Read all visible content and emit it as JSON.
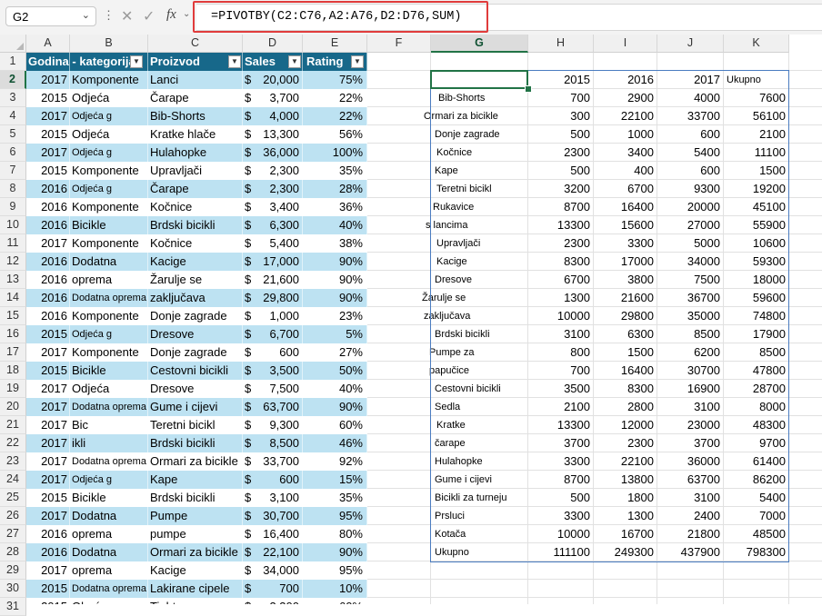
{
  "formula_bar": {
    "name_box": "G2",
    "formula": "=PIVOTBY(C2:C76,A2:A76,D2:D76,SUM)"
  },
  "icons": {
    "cancel": "x-icon",
    "enter": "checkmark-icon",
    "function": "fx-icon"
  },
  "columns": [
    "A",
    "B",
    "C",
    "D",
    "E",
    "F",
    "G",
    "H",
    "I",
    "J",
    "K"
  ],
  "selected_column": "G",
  "selected_row": "2",
  "rows": [
    "1",
    "2",
    "3",
    "4",
    "5",
    "6",
    "7",
    "8",
    "9",
    "10",
    "11",
    "12",
    "13",
    "14",
    "15",
    "16",
    "17",
    "18",
    "19",
    "20",
    "21",
    "22",
    "23",
    "24",
    "25",
    "26",
    "27",
    "28",
    "29",
    "30",
    "31"
  ],
  "table": {
    "headers": [
      "Godina - kategorija",
      "Proizvod",
      "Sales",
      "Rating"
    ],
    "rows": [
      {
        "year": "2017",
        "cat": "Komponente",
        "prod": "Lanci",
        "cur": "$",
        "sales": "20,000",
        "rating": "75%"
      },
      {
        "year": "2015",
        "cat": "Odjeća",
        "prod": "Čarape",
        "cur": "$",
        "sales": "3,700",
        "rating": "22%"
      },
      {
        "year": "2017",
        "cat": "Odjeća g",
        "prod": "Bib-Shorts",
        "cur": "$",
        "sales": "4,000",
        "rating": "22%"
      },
      {
        "year": "2015",
        "cat": "Odjeća",
        "prod": "Kratke hlače",
        "cur": "$",
        "sales": "13,300",
        "rating": "56%"
      },
      {
        "year": "2017",
        "cat": "Odjeća g",
        "prod": "Hulahopke",
        "cur": "$",
        "sales": "36,000",
        "rating": "100%"
      },
      {
        "year": "2015",
        "cat": "Komponente",
        "prod": "Upravljači",
        "cur": "$",
        "sales": "2,300",
        "rating": "35%"
      },
      {
        "year": "2016",
        "cat": "Odjeća g",
        "prod": "Čarape",
        "cur": "$",
        "sales": "2,300",
        "rating": "28%"
      },
      {
        "year": "2016",
        "cat": "Komponente",
        "prod": "Kočnice",
        "cur": "$",
        "sales": "3,400",
        "rating": "36%"
      },
      {
        "year": "2016",
        "cat": "Bicikle",
        "prod": "Brdski bicikli",
        "cur": "$",
        "sales": "6,300",
        "rating": "40%"
      },
      {
        "year": "2017",
        "cat": "Komponente",
        "prod": "Kočnice",
        "cur": "$",
        "sales": "5,400",
        "rating": "38%"
      },
      {
        "year": "2016",
        "cat": "Dodatna",
        "prod": "Kacige",
        "cur": "$",
        "sales": "17,000",
        "rating": "90%"
      },
      {
        "year": "2016",
        "cat": "oprema",
        "prod": "Žarulje se",
        "cur": "$",
        "sales": "21,600",
        "rating": "90%"
      },
      {
        "year": "2016",
        "cat": "Dodatna oprema",
        "prod": "zaključava",
        "cur": "$",
        "sales": "29,800",
        "rating": "90%"
      },
      {
        "year": "2016",
        "cat": "Komponente",
        "prod": "Donje zagrade",
        "cur": "$",
        "sales": "1,000",
        "rating": "23%"
      },
      {
        "year": "2015",
        "cat": "Odjeća g",
        "prod": "Dresove",
        "cur": "$",
        "sales": "6,700",
        "rating": "5%"
      },
      {
        "year": "2017",
        "cat": "Komponente",
        "prod": "Donje zagrade",
        "cur": "$",
        "sales": "600",
        "rating": "27%"
      },
      {
        "year": "2015",
        "cat": "Bicikle",
        "prod": "Cestovni bicikli",
        "cur": "$",
        "sales": "3,500",
        "rating": "50%"
      },
      {
        "year": "2017",
        "cat": "Odjeća",
        "prod": "Dresove",
        "cur": "$",
        "sales": "7,500",
        "rating": "40%"
      },
      {
        "year": "2017",
        "cat": "Dodatna oprema",
        "prod": "Gume i cijevi",
        "cur": "$",
        "sales": "63,700",
        "rating": "90%"
      },
      {
        "year": "2017",
        "cat": "Bic",
        "prod": "Teretni bicikl",
        "cur": "$",
        "sales": "9,300",
        "rating": "60%"
      },
      {
        "year": "2017",
        "cat": "ikli",
        "prod": "Brdski bicikli",
        "cur": "$",
        "sales": "8,500",
        "rating": "46%"
      },
      {
        "year": "2017",
        "cat": "Dodatna oprema",
        "prod": "Ormari za bicikle",
        "cur": "$",
        "sales": "33,700",
        "rating": "92%"
      },
      {
        "year": "2017",
        "cat": "Odjeća g",
        "prod": "Kape",
        "cur": "$",
        "sales": "600",
        "rating": "15%"
      },
      {
        "year": "2015",
        "cat": "Bicikle",
        "prod": "Brdski bicikli",
        "cur": "$",
        "sales": "3,100",
        "rating": "35%"
      },
      {
        "year": "2017",
        "cat": "Dodatna",
        "prod": "Pumpe",
        "cur": "$",
        "sales": "30,700",
        "rating": "95%"
      },
      {
        "year": "2016",
        "cat": "oprema",
        "prod": "pumpe",
        "cur": "$",
        "sales": "16,400",
        "rating": "80%"
      },
      {
        "year": "2016",
        "cat": "Dodatna",
        "prod": "Ormari za bicikle",
        "cur": "$",
        "sales": "22,100",
        "rating": "90%"
      },
      {
        "year": "2017",
        "cat": "oprema",
        "prod": "Kacige",
        "cur": "$",
        "sales": "34,000",
        "rating": "95%"
      },
      {
        "year": "2015",
        "cat": "Dodatna oprema",
        "prod": "Lakirane cipele",
        "cur": "$",
        "sales": "700",
        "rating": "10%"
      },
      {
        "year": "2015",
        "cat": "Obuća",
        "prod": "Tights",
        "cur": "$",
        "sales": "3,300",
        "rating": "60%"
      }
    ]
  },
  "pivot": {
    "header": [
      "",
      "2015",
      "2016",
      "2017",
      "Ukupno"
    ],
    "rows": [
      {
        "label": "Bib-Shorts",
        "v": [
          "700",
          "2900",
          "4000",
          "7600"
        ]
      },
      {
        "label": "Ormari za bicikle",
        "v": [
          "300",
          "22100",
          "33700",
          "56100"
        ]
      },
      {
        "label": "Donje zagrade",
        "v": [
          "500",
          "1000",
          "600",
          "2100"
        ]
      },
      {
        "label": "Kočnice",
        "v": [
          "2300",
          "3400",
          "5400",
          "11100"
        ]
      },
      {
        "label": "Kape",
        "v": [
          "500",
          "400",
          "600",
          "1500"
        ]
      },
      {
        "label": "Teretni bicikl",
        "v": [
          "3200",
          "6700",
          "9300",
          "19200"
        ]
      },
      {
        "label": "Rukavice",
        "v": [
          "8700",
          "16400",
          "20000",
          "45100"
        ]
      },
      {
        "label": "s lancima",
        "v": [
          "13300",
          "15600",
          "27000",
          "55900"
        ]
      },
      {
        "label": "Upravljači",
        "v": [
          "2300",
          "3300",
          "5000",
          "10600"
        ]
      },
      {
        "label": "Kacige",
        "v": [
          "8300",
          "17000",
          "34000",
          "59300"
        ]
      },
      {
        "label": "Dresove",
        "v": [
          "6700",
          "3800",
          "7500",
          "18000"
        ]
      },
      {
        "label": "Žarulje se",
        "v": [
          "1300",
          "21600",
          "36700",
          "59600"
        ]
      },
      {
        "label": "zaključava",
        "v": [
          "10000",
          "29800",
          "35000",
          "74800"
        ]
      },
      {
        "label": "Brdski bicikli",
        "v": [
          "3100",
          "6300",
          "8500",
          "17900"
        ]
      },
      {
        "label": "Pumpe za",
        "v": [
          "800",
          "1500",
          "6200",
          "8500"
        ]
      },
      {
        "label": "papučice",
        "v": [
          "700",
          "16400",
          "30700",
          "47800"
        ]
      },
      {
        "label": "Cestovni bicikli",
        "v": [
          "3500",
          "8300",
          "16900",
          "28700"
        ]
      },
      {
        "label": "Sedla",
        "v": [
          "2100",
          "2800",
          "3100",
          "8000"
        ]
      },
      {
        "label": "Kratke",
        "v": [
          "13300",
          "12000",
          "23000",
          "48300"
        ]
      },
      {
        "label": "čarape",
        "v": [
          "3700",
          "2300",
          "3700",
          "9700"
        ]
      },
      {
        "label": "Hulahopke",
        "v": [
          "3300",
          "22100",
          "36000",
          "61400"
        ]
      },
      {
        "label": "Gume i cijevi",
        "v": [
          "8700",
          "13800",
          "63700",
          "86200"
        ]
      },
      {
        "label": "Bicikli za turneju",
        "v": [
          "500",
          "1800",
          "3100",
          "5400"
        ]
      },
      {
        "label": "Prsluci",
        "v": [
          "3300",
          "1300",
          "2400",
          "7000"
        ]
      },
      {
        "label": "Kotača",
        "v": [
          "10000",
          "16700",
          "21800",
          "48500"
        ]
      },
      {
        "label": "Ukupno",
        "v": [
          "111100",
          "249300",
          "437900",
          "798300"
        ]
      }
    ]
  }
}
